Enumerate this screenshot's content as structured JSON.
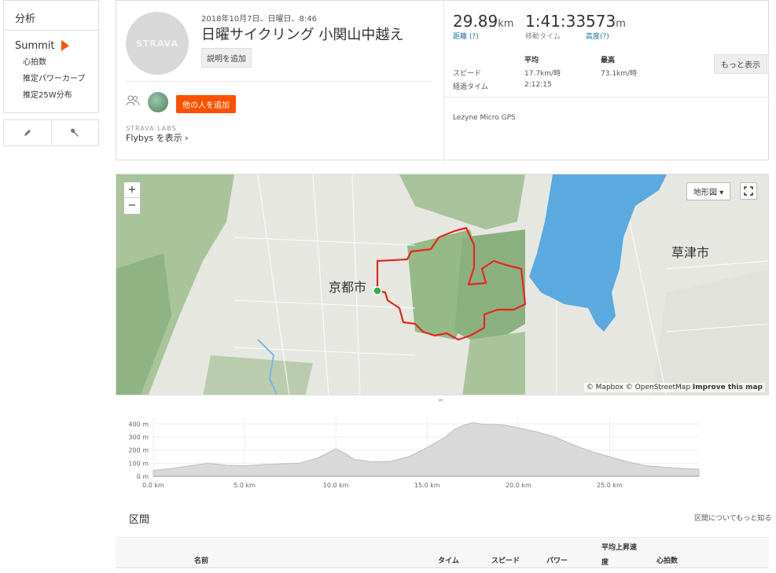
{
  "sidebar": {
    "analysis": "分析",
    "summit": "Summit",
    "links": [
      "心拍数",
      "推定パワーカーブ",
      "推定25W分布"
    ]
  },
  "activity": {
    "avatar_text": "STRAVA",
    "datetime": "2018年10月7日、日曜日、8:46",
    "title": "日曜サイクリング 小関山中越え",
    "add_description": "説明を追加",
    "add_others": "他の人を追加",
    "labs": "STRAVA LABS",
    "flybys": "Flybys を表示"
  },
  "stats": {
    "distance": {
      "value": "29.89",
      "unit": "km",
      "label": "距離 (?)"
    },
    "moving_time": {
      "value": "1:41:33",
      "label": "移動タイム"
    },
    "elevation": {
      "value": "573",
      "unit": "m",
      "label": "高度(?)"
    },
    "more_button": "もっと表示",
    "table": {
      "col_avg": "平均",
      "col_max": "最高",
      "speed_label": "スピード",
      "speed_avg": "17.7km/時",
      "speed_max": "73.1km/時",
      "elapsed_label": "経過タイム",
      "elapsed_value": "2:12:15"
    },
    "device": "Lezyne Micro GPS"
  },
  "map": {
    "zoom_in": "+",
    "zoom_out": "−",
    "type_button": "地形図",
    "city_kyoto": "京都市",
    "city_kusatsu": "草津市",
    "attribution_1": "© Mapbox © OpenStreetMap",
    "attribution_2": "Improve this map",
    "route_color": "#e8251d",
    "start_color": "#2bb34a",
    "lake_color": "#5aa9e0"
  },
  "elevation_chart": {
    "chart_data": {
      "type": "area",
      "title": "",
      "xlabel": "",
      "ylabel": "",
      "x_ticks": [
        "0.0 km",
        "5.0 km",
        "10.0 km",
        "15.0 km",
        "20.0 km",
        "25.0 km"
      ],
      "y_ticks": [
        "0 m",
        "100 m",
        "200 m",
        "300 m",
        "400 m"
      ],
      "xlim": [
        0,
        29.89
      ],
      "ylim": [
        0,
        450
      ],
      "x": [
        0,
        1,
        2,
        3,
        4,
        5,
        6,
        7,
        8,
        9,
        10,
        10.5,
        11,
        12,
        13,
        14,
        15,
        16,
        16.5,
        17,
        17.5,
        18,
        18.5,
        19,
        19.5,
        20,
        21,
        22,
        23,
        24,
        25,
        26,
        27,
        28,
        29,
        29.89
      ],
      "y": [
        45,
        60,
        80,
        100,
        85,
        80,
        90,
        95,
        100,
        140,
        210,
        175,
        130,
        110,
        115,
        150,
        220,
        300,
        360,
        390,
        410,
        400,
        395,
        395,
        385,
        370,
        340,
        300,
        240,
        190,
        150,
        110,
        80,
        70,
        60,
        55
      ]
    }
  },
  "segments": {
    "title": "区間",
    "help_link": "区間についてもっと知る",
    "columns": {
      "name": "名前",
      "time": "タイム",
      "speed": "スピード",
      "power": "パワー",
      "vam_1": "平均上昇速",
      "vam_2": "度",
      "hr": "心拍数"
    }
  }
}
